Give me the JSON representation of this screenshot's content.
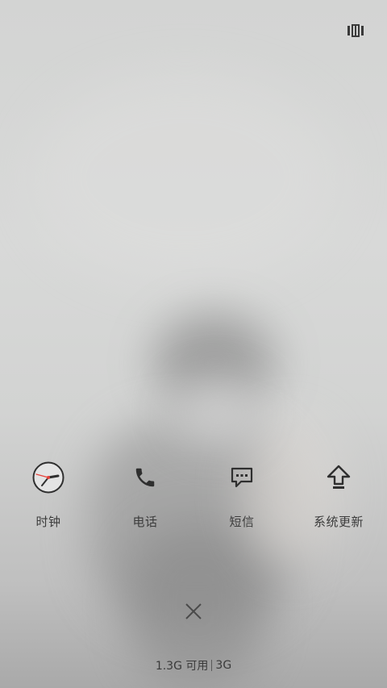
{
  "apps": [
    {
      "label": "时钟",
      "icon": "clock-icon"
    },
    {
      "label": "电话",
      "icon": "phone-icon"
    },
    {
      "label": "短信",
      "icon": "message-icon"
    },
    {
      "label": "系统更新",
      "icon": "upload-arrow-icon"
    }
  ],
  "controls": {
    "recents_icon": "recents-grid-icon",
    "close_icon": "close-icon"
  },
  "status": {
    "memory_available": "1.3G 可用",
    "network": "3G"
  },
  "colors": {
    "icon": "#2f2f2f",
    "clock_second_hand": "#e8433b",
    "label_text": "#3c3c3c"
  }
}
